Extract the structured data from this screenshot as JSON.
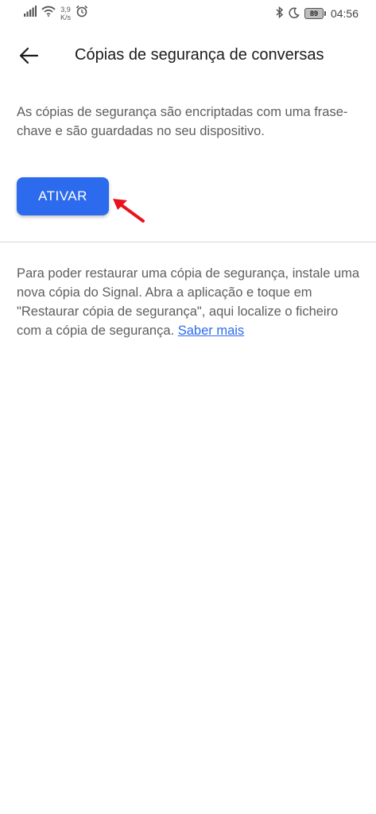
{
  "status_bar": {
    "speed_value": "3,9",
    "speed_unit": "K/s",
    "battery": "89",
    "time": "04:56",
    "icons": [
      "signal-icon",
      "wifi-icon",
      "alarm-icon",
      "bluetooth-icon",
      "moon-icon",
      "battery-icon"
    ]
  },
  "toolbar": {
    "title": "Cópias de segurança de conversas",
    "back_icon": "arrow-left-icon"
  },
  "main": {
    "description": "As cópias de segurança são encriptadas com uma frase-chave e são guardadas no seu dispositivo.",
    "activate_label": "ATIVAR",
    "restore_text": "Para poder restaurar uma cópia de segurança, instale uma nova cópia do Signal. Abra a aplicação e toque em \"Restaurar cópia de segurança\", aqui localize o ficheiro com a cópia de segurança. ",
    "learn_more": "Saber mais"
  },
  "colors": {
    "accent": "#2c6bed",
    "annotation_arrow": "#e8131b",
    "text_secondary": "#5e5e5e"
  }
}
